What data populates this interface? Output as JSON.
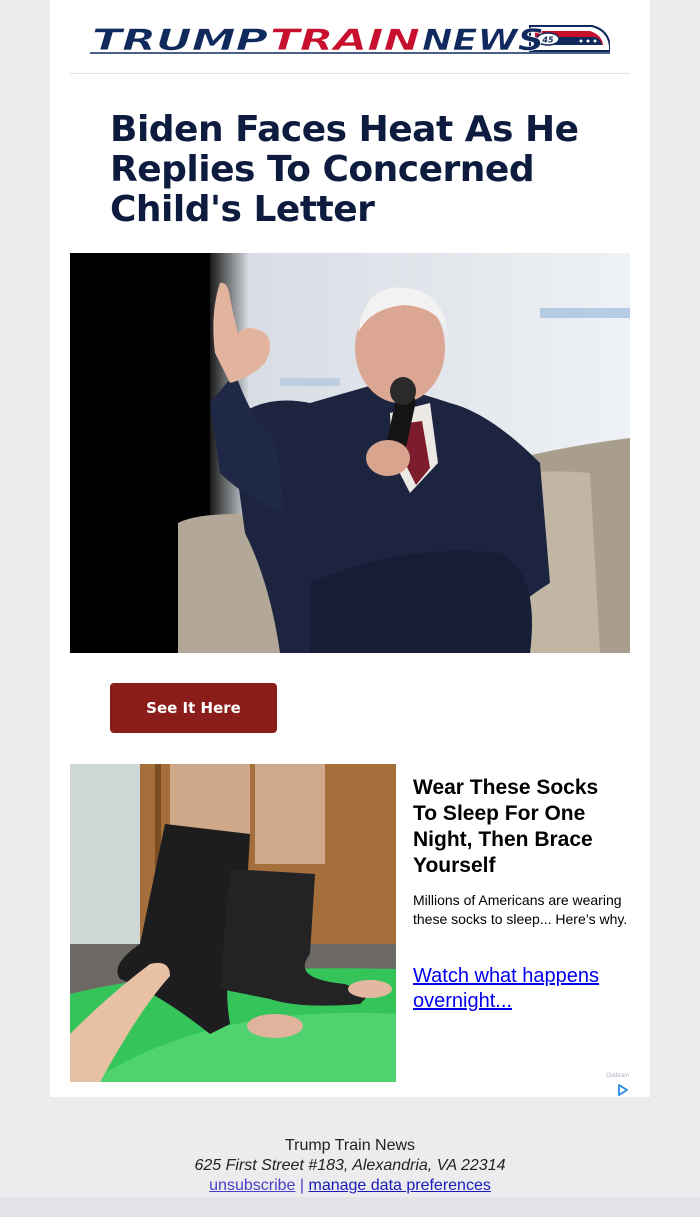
{
  "header": {
    "logo_part1": "TRUMP",
    "logo_part2": "TRAIN",
    "logo_part3": "NEWS",
    "logo_badge": "45",
    "colors": {
      "navy": "#112a5e",
      "red": "#c8102e"
    }
  },
  "article": {
    "headline": "Biden Faces Heat As He Replies To Concerned Child's Letter",
    "cta_label": "See It Here",
    "cta_color": "#8a1d1a"
  },
  "ad": {
    "title": "Wear These Socks To Sleep For One Night, Then Brace Yourself",
    "description": "Millions of Americans are wearing these socks to sleep... Here’s why.",
    "link_text": "Watch what happens overnight...",
    "brand": "Outbrain",
    "choices_icon": "adchoices-play-icon"
  },
  "footer": {
    "company": "Trump Train News",
    "address": "625 First Street #183, Alexandria, VA 22314",
    "unsubscribe": "unsubscribe",
    "separator": "|",
    "manage": "manage data preferences"
  }
}
